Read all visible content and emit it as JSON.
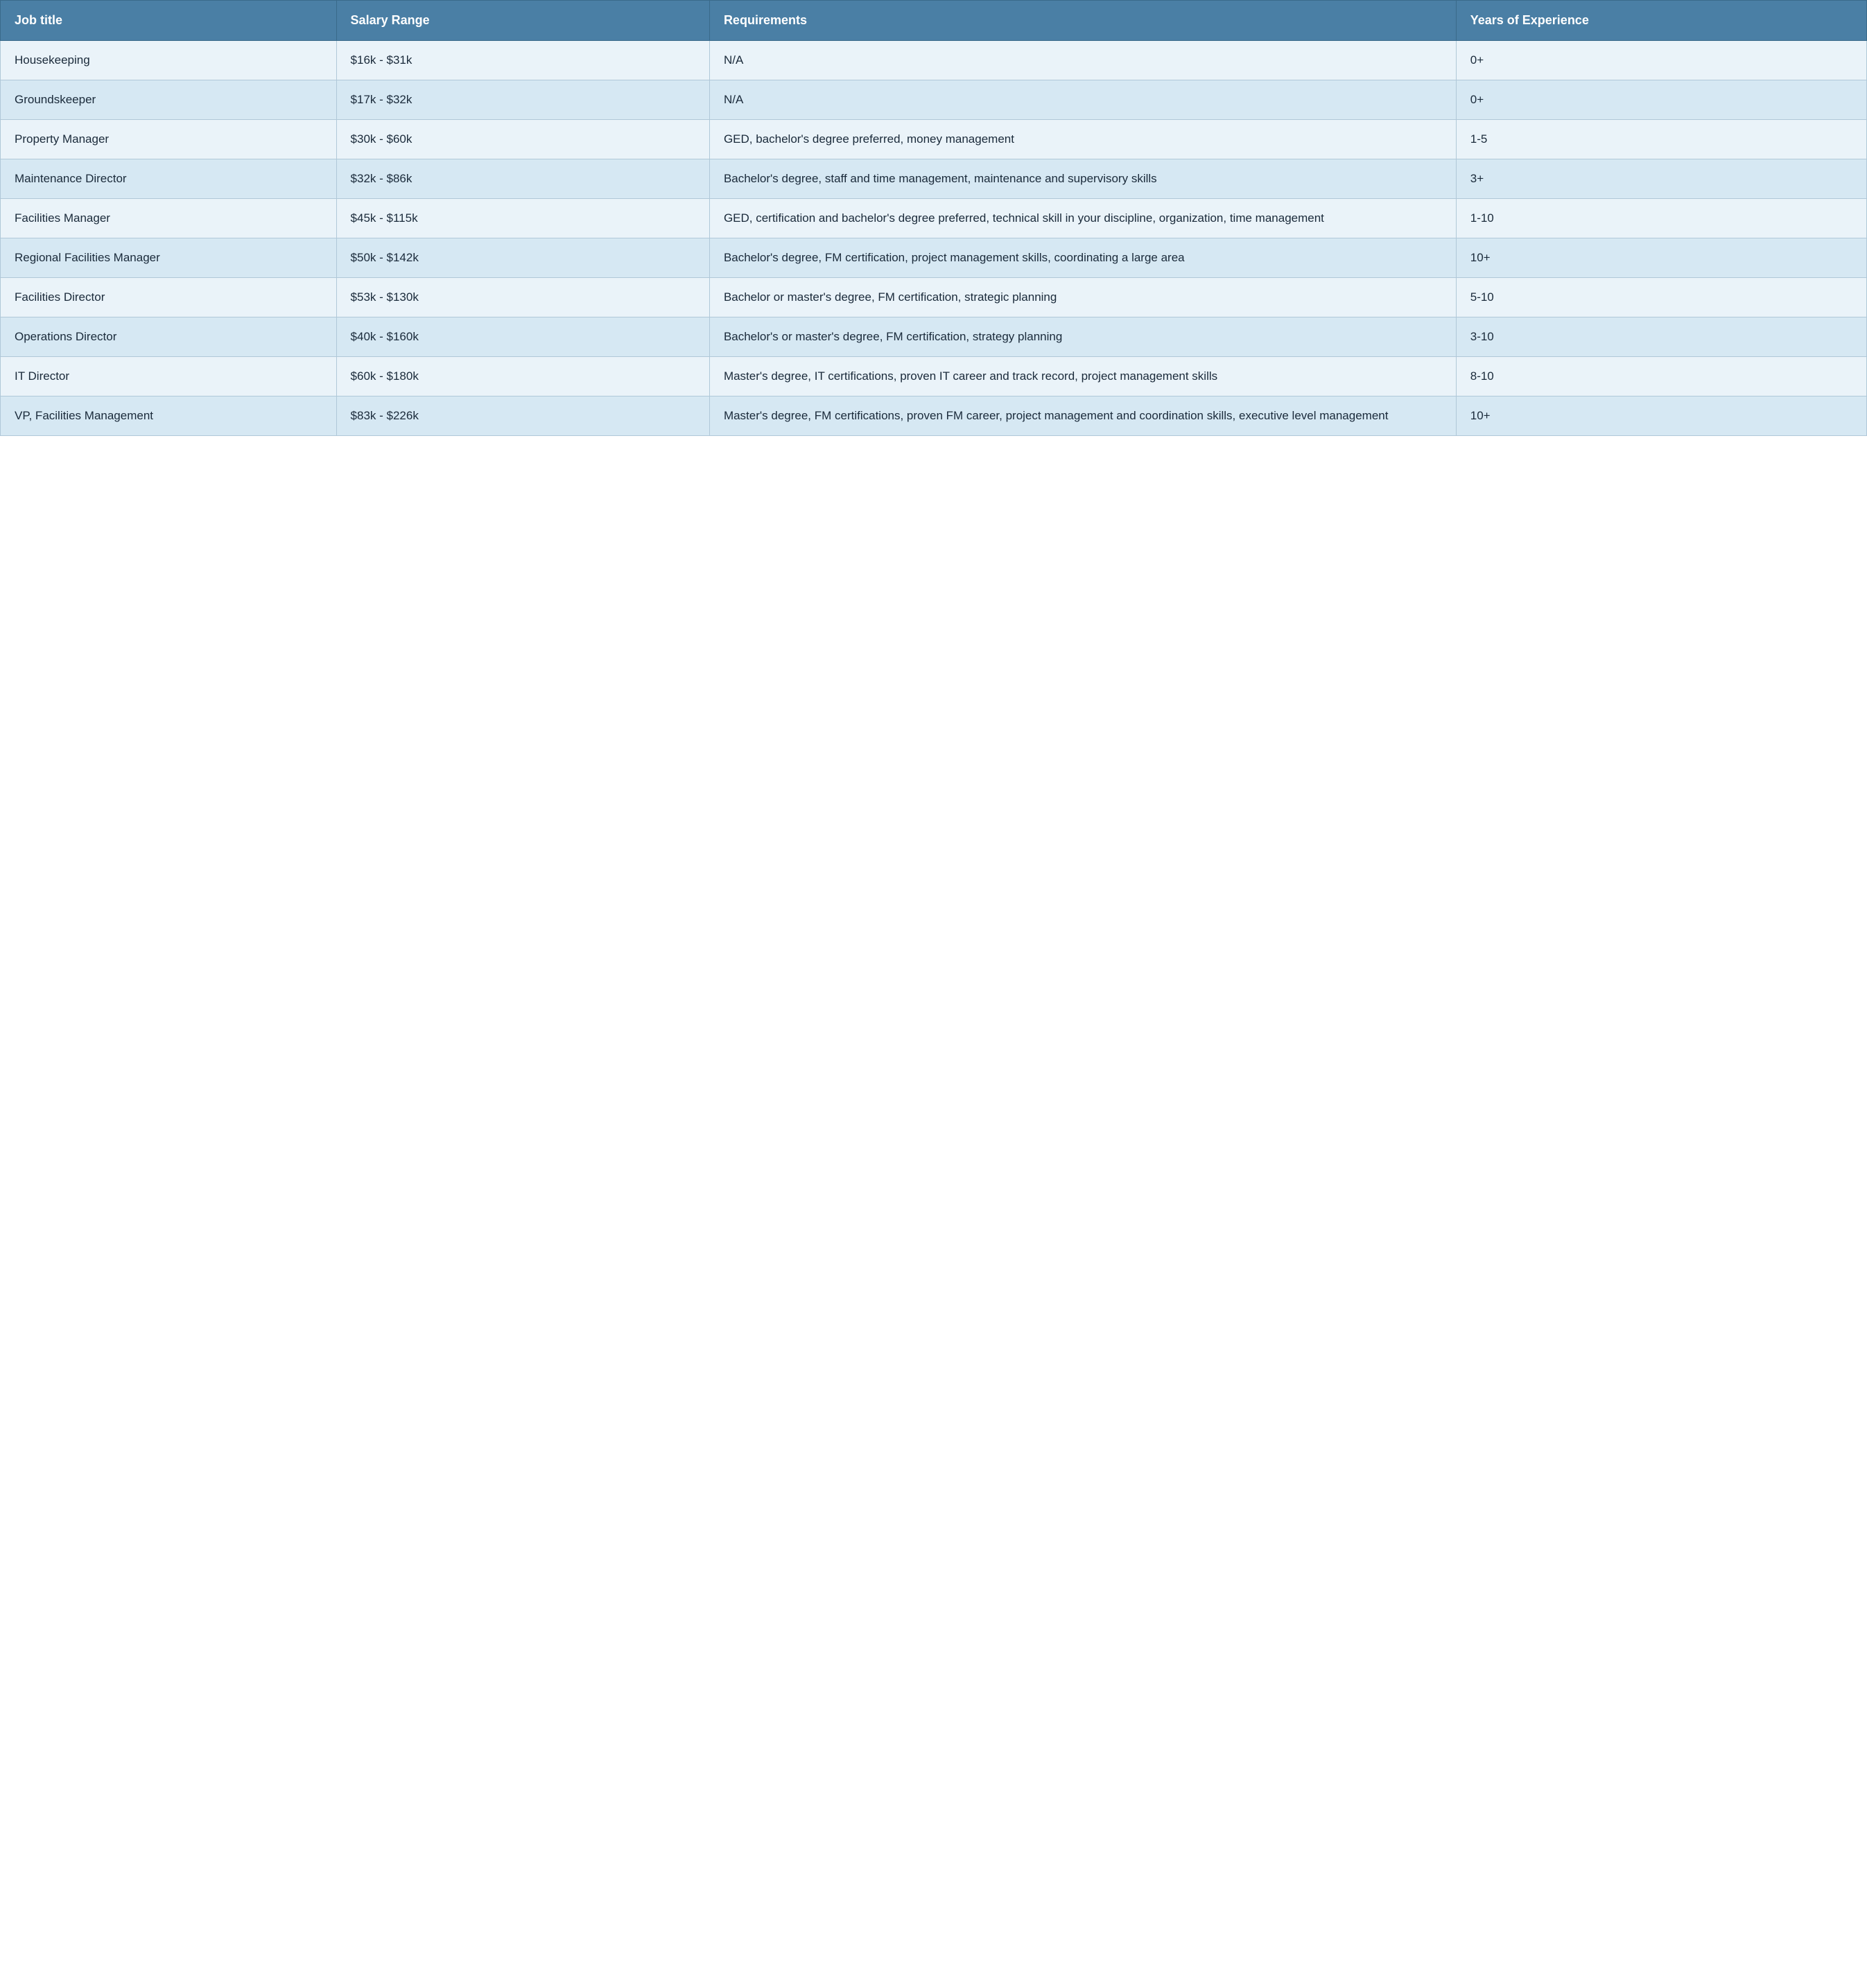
{
  "table": {
    "headers": {
      "job_title": "Job title",
      "salary_range": "Salary Range",
      "requirements": "Requirements",
      "years_experience": "Years of Experience"
    },
    "rows": [
      {
        "job_title": "Housekeeping",
        "salary_range": "$16k - $31k",
        "requirements": "N/A",
        "years_experience": "0+"
      },
      {
        "job_title": "Groundskeeper",
        "salary_range": "$17k - $32k",
        "requirements": "N/A",
        "years_experience": "0+"
      },
      {
        "job_title": "Property Manager",
        "salary_range": "$30k - $60k",
        "requirements": "GED, bachelor's degree preferred, money management",
        "years_experience": "1-5"
      },
      {
        "job_title": "Maintenance Director",
        "salary_range": "$32k - $86k",
        "requirements": "Bachelor's degree, staff and time management, maintenance and supervisory skills",
        "years_experience": "3+"
      },
      {
        "job_title": "Facilities Manager",
        "salary_range": "$45k - $115k",
        "requirements": "GED, certification and bachelor's degree preferred, technical skill in your discipline, organization, time management",
        "years_experience": "1-10"
      },
      {
        "job_title": "Regional Facilities Manager",
        "salary_range": "$50k - $142k",
        "requirements": "Bachelor's degree, FM certification,  project management skills, coordinating a large area",
        "years_experience": "10+"
      },
      {
        "job_title": "Facilities Director",
        "salary_range": "$53k - $130k",
        "requirements": "Bachelor or master's degree, FM certification, strategic planning",
        "years_experience": "5-10"
      },
      {
        "job_title": "Operations Director",
        "salary_range": "$40k - $160k",
        "requirements": "Bachelor's or master's degree, FM certification, strategy planning",
        "years_experience": "3-10"
      },
      {
        "job_title": "IT Director",
        "salary_range": "$60k - $180k",
        "requirements": "Master's degree, IT certifications, proven IT career and track record, project management skills",
        "years_experience": "8-10"
      },
      {
        "job_title": "VP, Facilities Management",
        "salary_range": "$83k - $226k",
        "requirements": "Master's degree, FM certifications, proven FM career, project management and coordination skills, executive level management",
        "years_experience": "10+"
      }
    ]
  }
}
